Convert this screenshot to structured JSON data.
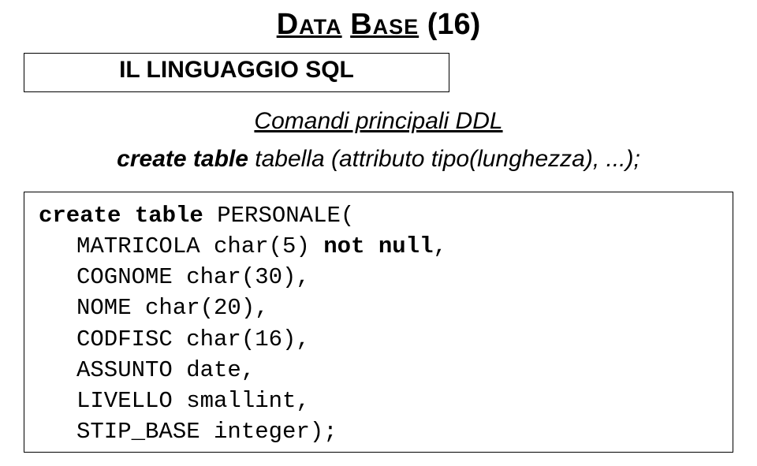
{
  "title": {
    "data_word": "Data",
    "base_word": "Base",
    "number": "(16)"
  },
  "subtitle": "IL LINGUAGGIO SQL",
  "section": "Comandi principali DDL",
  "definition": {
    "keyword": "create table",
    "rest": " tabella (attributo tipo(lunghezza), ...);"
  },
  "code": {
    "l1a": "create table",
    "l1b": " PERSONALE(",
    "l2a": "MATRICOLA char(5) ",
    "l2b": "not null",
    "l2c": ",",
    "l3": "COGNOME char(30),",
    "l4": "NOME char(20),",
    "l5": "CODFISC char(16),",
    "l6": "ASSUNTO date,",
    "l7": "LIVELLO smallint,",
    "l8": "STIP_BASE integer);"
  }
}
